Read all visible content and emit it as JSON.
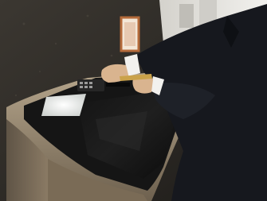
{
  "photo": {
    "subject": "hotel-kiosk-check-in",
    "palette": {
      "wall": "#2b2824",
      "wall_light": "#4a443c",
      "counter_wood": "#8a7a64",
      "counter_top": "#b8a98f",
      "device_body": "#151515",
      "screen_glow": "#e9ecea",
      "suit": "#16181e",
      "shirt": "#f2f1ee",
      "skin": "#d9b48f",
      "card": "#caa24a",
      "sign": "#f4e7d7",
      "sign_border": "#b46a3a",
      "background_light": "#e7e6e2"
    }
  }
}
